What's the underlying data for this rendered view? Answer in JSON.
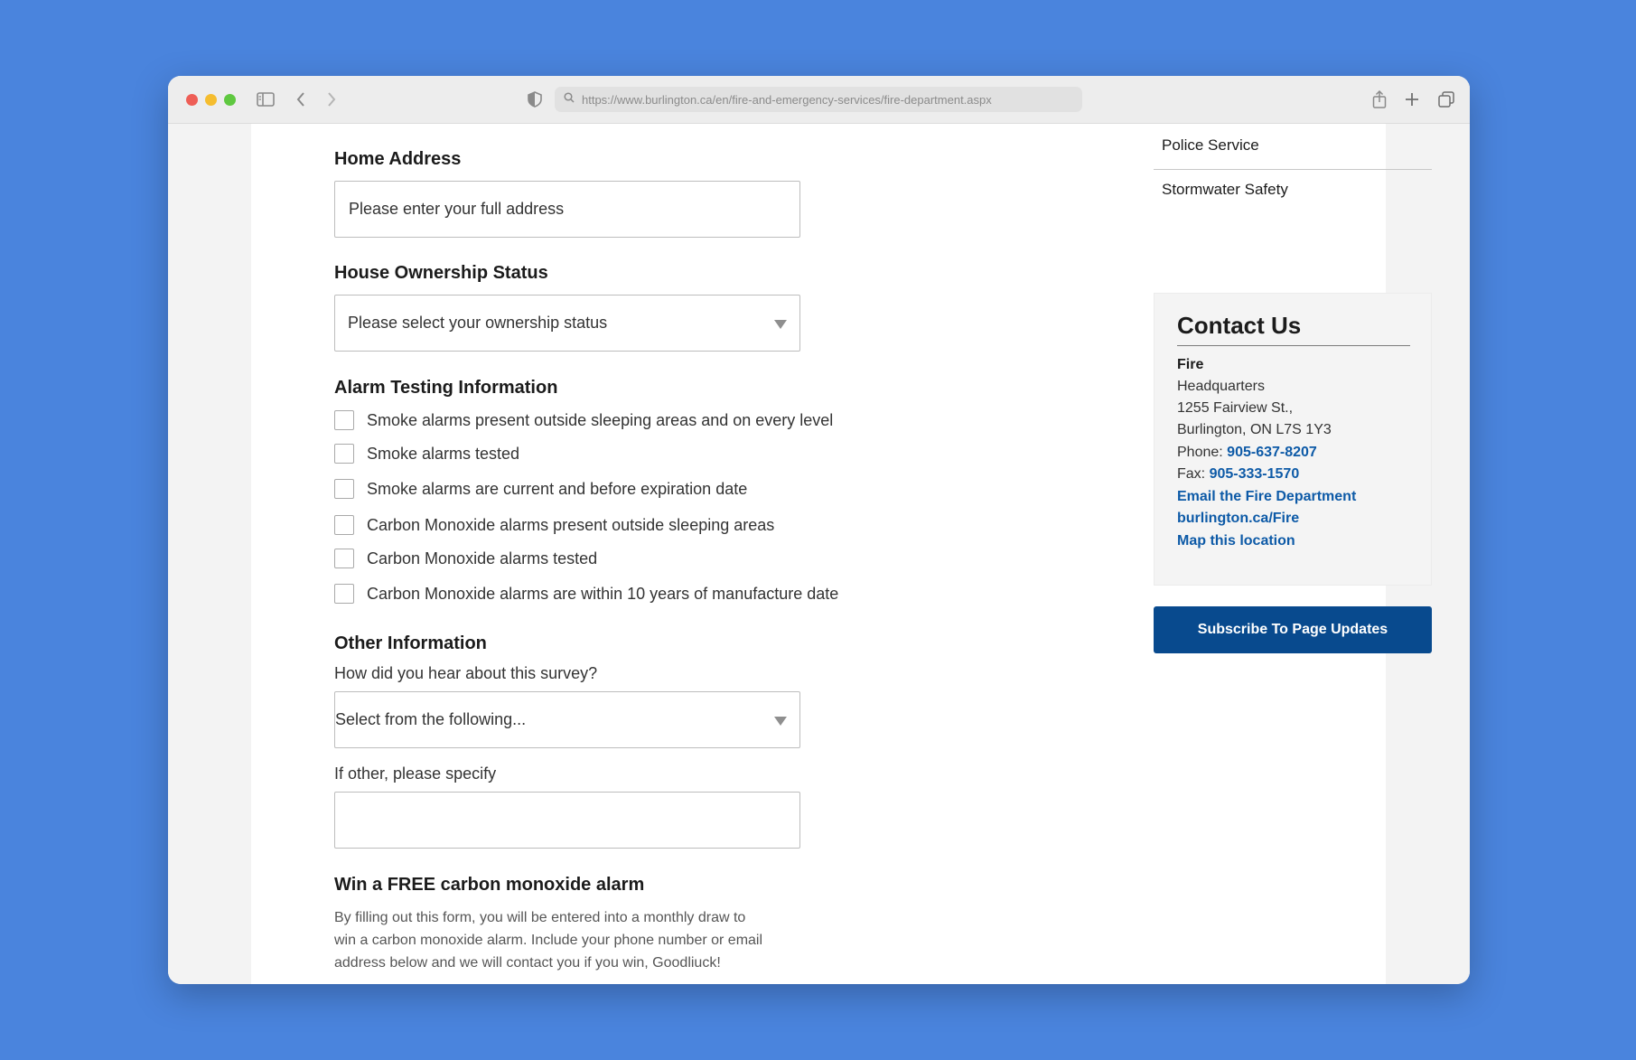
{
  "browser": {
    "url": "https://www.burlington.ca/en/fire-and-emergency-services/fire-department.aspx"
  },
  "form": {
    "home_address": {
      "label": "Home Address",
      "placeholder": "Please enter your full address"
    },
    "ownership": {
      "label": "House Ownership Status",
      "selected": "Please select your ownership status"
    },
    "alarm_section": {
      "title": "Alarm Testing Information",
      "items": [
        "Smoke alarms present outside sleeping areas and on every level",
        "Smoke alarms tested",
        "Smoke alarms are current and before expiration date",
        "Carbon Monoxide alarms present outside sleeping areas",
        "Carbon Monoxide alarms tested",
        "Carbon Monoxide alarms are within 10 years of manufacture date"
      ]
    },
    "other_section": {
      "title": "Other Information",
      "hear_label": "How did you hear about this survey?",
      "hear_selected": "Select from the following...",
      "specify_label": "If other, please specify"
    },
    "win_section": {
      "title": "Win a FREE carbon monoxide alarm",
      "text_lines": [
        "By filling out this form, you will be entered into a monthly draw to",
        "win a carbon monoxide alarm. Include your phone number or email",
        "address below and we will contact you if you win, Goodliuck!"
      ]
    }
  },
  "sidebar": {
    "links": [
      "Police Service",
      "Stormwater Safety"
    ],
    "contact": {
      "title": "Contact Us",
      "department": "Fire",
      "lines": [
        "Headquarters",
        "1255 Fairview St.,",
        "Burlington, ON L7S 1Y3"
      ],
      "phone_label": "Phone:",
      "phone": "905-637-8207",
      "fax_label": "Fax:",
      "fax": "905-333-1570",
      "email_link": "Email the Fire Department",
      "web_link": "burlington.ca/Fire",
      "map_link": "Map this location"
    },
    "subscribe_label": "Subscribe To Page Updates"
  },
  "colors": {
    "desktop_bg": "#4a84dd",
    "link": "#0d5aa7",
    "button": "#084a8e"
  }
}
